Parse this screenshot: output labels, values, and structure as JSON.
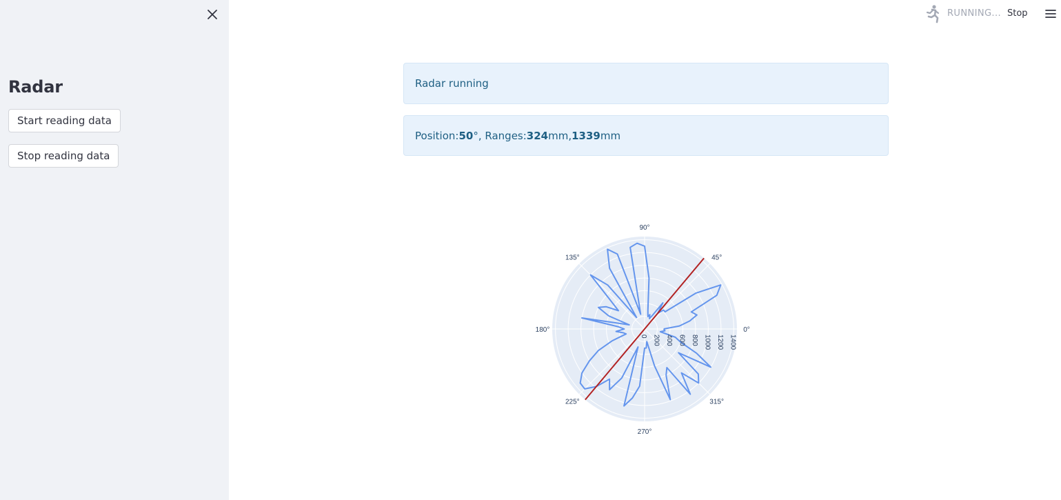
{
  "sidebar": {
    "title": "Radar",
    "buttons": [
      "Start reading data",
      "Stop reading data"
    ],
    "close_icon": "close-icon"
  },
  "header": {
    "status_text": "RUNNING...",
    "stop_label": "Stop",
    "status_icon": "running-man-icon",
    "menu_icon": "hamburger-menu-icon"
  },
  "main": {
    "status_message": "Radar running",
    "position": {
      "label": "Position: ",
      "value": "50",
      "unit": "°",
      "ranges_label": ", Ranges: ",
      "range1": "324",
      "range1_unit": " mm, ",
      "range2": "1339",
      "range2_unit": " mm"
    }
  },
  "colors": {
    "sidebar_bg": "#f0f2f6",
    "alert_bg": "#e8f2fc",
    "alert_text": "#1e5f83",
    "polar_bg": "#e5ecf6",
    "trace": "#6495ed",
    "sweep": "#b22222"
  },
  "chart_data": {
    "type": "polar-line",
    "angular_ticks": [
      "0°",
      "45°",
      "90°",
      "135°",
      "180°",
      "225°",
      "270°",
      "315°"
    ],
    "radial_ticks": [
      "0",
      "200",
      "400",
      "600",
      "800",
      "1000",
      "1200",
      "1400"
    ],
    "radial_range": [
      0,
      1450
    ],
    "grid": true,
    "sweep_angle": 50,
    "sweep_line_angles": [
      50,
      230
    ],
    "series": [
      {
        "theta": [
          0,
          5,
          10,
          15,
          20,
          25,
          30,
          35,
          40,
          45,
          50,
          55,
          60,
          65,
          70,
          75,
          80,
          85,
          90,
          95,
          100,
          105,
          110,
          115,
          120,
          125,
          130,
          135,
          140,
          145,
          150,
          155,
          160,
          165,
          170,
          175,
          180,
          185,
          190,
          195,
          200,
          205,
          210,
          215,
          220,
          225,
          230,
          235,
          240,
          245,
          250,
          255,
          260,
          265,
          270,
          275,
          280,
          285,
          290,
          295,
          300,
          305,
          310,
          315,
          320,
          325,
          330,
          335,
          340,
          345,
          350,
          355
        ],
        "r": [
          300,
          550,
          720,
          850,
          780,
          1250,
          1380,
          980,
          420,
          420,
          324,
          500,
          250,
          180,
          240,
          200,
          300,
          800,
          1300,
          1350,
          1300,
          240,
          1250,
          1380,
          1100,
          220,
          900,
          1200,
          700,
          500,
          700,
          800,
          600,
          250,
          1000,
          420,
          320,
          450,
          340,
          300,
          540,
          800,
          1000,
          1200,
          1320,
          1330,
          1180,
          960,
          1100,
          850,
          300,
          1250,
          1100,
          900,
          300,
          300,
          200,
          600,
          1180,
          800,
          700,
          1250,
          900,
          1200,
          1100,
          650,
          1200,
          900,
          600,
          500,
          250,
          320
        ]
      }
    ]
  }
}
